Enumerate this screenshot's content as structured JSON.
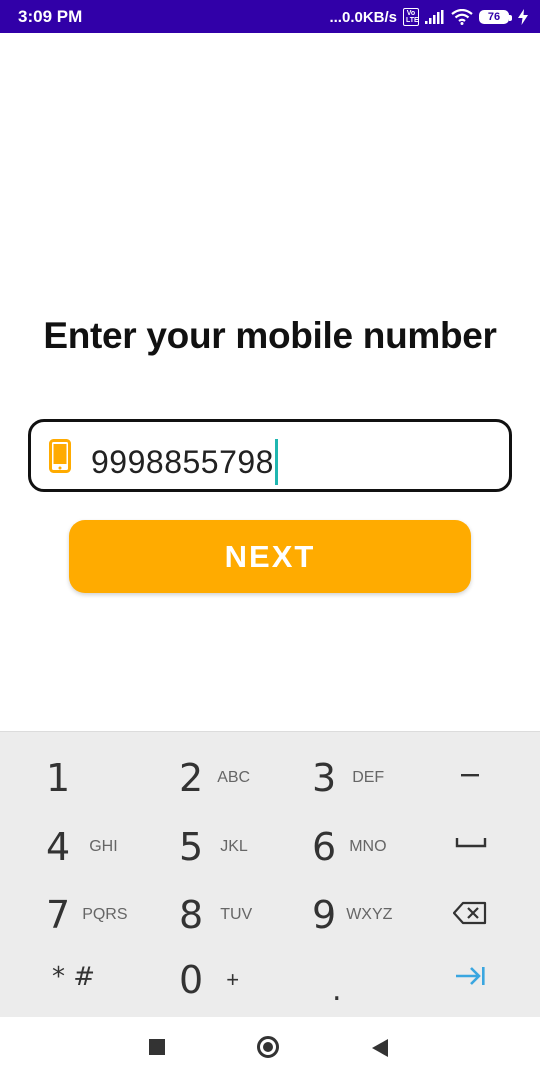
{
  "status_bar": {
    "time": "3:09 PM",
    "network_speed": "...0.0KB/s",
    "volte_label": "Vo LTE",
    "battery_level": "76",
    "icons": [
      "signal-icon",
      "wifi-icon",
      "battery-icon",
      "charging-icon"
    ]
  },
  "main": {
    "title": "Enter your mobile number",
    "phone_input": {
      "value": "9998855798",
      "icon": "mobile-phone-icon"
    },
    "next_button": "NEXT"
  },
  "colors": {
    "status_bar": "#3100a8",
    "accent": "#ffab00",
    "caret": "#1fb6b0",
    "keypad_bg": "#ececec"
  },
  "keypad": {
    "keys": [
      {
        "num": "1",
        "letters": ""
      },
      {
        "num": "2",
        "letters": "ABC"
      },
      {
        "num": "3",
        "letters": "DEF"
      },
      {
        "num": "–",
        "letters": ""
      },
      {
        "num": "4",
        "letters": "GHI"
      },
      {
        "num": "5",
        "letters": "JKL"
      },
      {
        "num": "6",
        "letters": "MNO"
      },
      {
        "num": "space",
        "letters": ""
      },
      {
        "num": "7",
        "letters": "PQRS"
      },
      {
        "num": "8",
        "letters": "TUV"
      },
      {
        "num": "9",
        "letters": "WXYZ"
      },
      {
        "num": "backspace",
        "letters": ""
      },
      {
        "num": "* #",
        "letters": ""
      },
      {
        "num": "0",
        "letters": "+"
      },
      {
        "num": ".",
        "letters": ""
      },
      {
        "num": "next",
        "letters": ""
      }
    ]
  },
  "nav_bar": {
    "icons": [
      "recents-icon",
      "home-icon",
      "back-icon"
    ]
  }
}
